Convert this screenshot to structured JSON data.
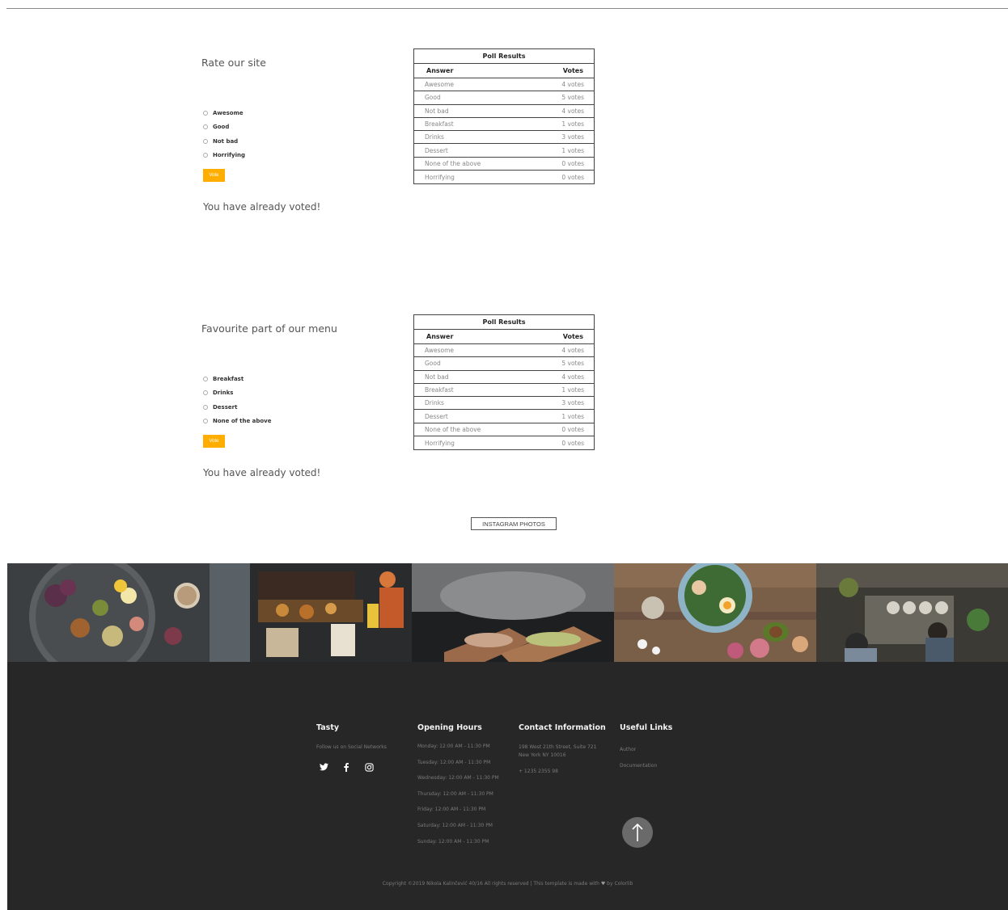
{
  "polls": [
    {
      "title": "Rate our site",
      "options": [
        "Awesome",
        "Good",
        "Not bad",
        "Horrifying"
      ],
      "vote_label": "Vote",
      "voted_message": "You have already voted!",
      "results_caption": "Poll Results",
      "col_answer": "Answer",
      "col_votes": "Votes",
      "results": [
        {
          "answer": "Awesome",
          "votes": "4 votes"
        },
        {
          "answer": "Good",
          "votes": "5 votes"
        },
        {
          "answer": "Not bad",
          "votes": "4 votes"
        },
        {
          "answer": "Breakfast",
          "votes": "1 votes"
        },
        {
          "answer": "Drinks",
          "votes": "3 votes"
        },
        {
          "answer": "Dessert",
          "votes": "1 votes"
        },
        {
          "answer": "None of the above",
          "votes": "0 votes"
        },
        {
          "answer": "Horrifying",
          "votes": "0 votes"
        }
      ]
    },
    {
      "title": "Favourite part of our menu",
      "options": [
        "Breakfast",
        "Drinks",
        "Dessert",
        "None of the above"
      ],
      "vote_label": "Vote",
      "voted_message": "You have already voted!",
      "results_caption": "Poll Results",
      "col_answer": "Answer",
      "col_votes": "Votes",
      "results": [
        {
          "answer": "Awesome",
          "votes": "4 votes"
        },
        {
          "answer": "Good",
          "votes": "5 votes"
        },
        {
          "answer": "Not bad",
          "votes": "4 votes"
        },
        {
          "answer": "Breakfast",
          "votes": "1 votes"
        },
        {
          "answer": "Drinks",
          "votes": "3 votes"
        },
        {
          "answer": "Dessert",
          "votes": "1 votes"
        },
        {
          "answer": "None of the above",
          "votes": "0 votes"
        },
        {
          "answer": "Horrifying",
          "votes": "0 votes"
        }
      ]
    }
  ],
  "instagram": {
    "button_label": "INSTAGRAM PHOTOS",
    "photos": [
      "fruit-cheese-platter-photo",
      "kitchen-grill-photo",
      "smoking-fish-photo",
      "salad-bowl-photo",
      "restaurant-kitchen-photo"
    ]
  },
  "footer": {
    "brand": "Tasty",
    "follow_text": "Follow us on Social Networks",
    "social_icons": [
      "twitter-icon",
      "facebook-icon",
      "instagram-icon"
    ],
    "hours_title": "Opening Hours",
    "hours": [
      "Monday: 12:00 AM - 11:30 PM",
      "Tuesday: 12:00 AM - 11:30 PM",
      "Wednesday: 12:00 AM - 11:30 PM",
      "Thursday: 12:00 AM - 11:30 PM",
      "Friday: 12:00 AM - 11:30 PM",
      "Saturday: 12:00 AM - 11:30 PM",
      "Sunday: 12:00 AM - 11:30 PM"
    ],
    "contact_title": "Contact Information",
    "address_line1": "198 West 21th Street, Suite 721",
    "address_line2": "New York NY 10016",
    "phone": "+ 1235 2355 98",
    "links_title": "Useful Links",
    "links": [
      "Author",
      "Documentation"
    ],
    "copyright_before": "Copyright ©2019 Nikola Kalinčević 40/16 All rights reserved | This template is made with",
    "copyright_after": "by Colorlib",
    "heart": "♥"
  },
  "colors": {
    "accent": "#ffae00",
    "footer_bg": "#272727"
  }
}
